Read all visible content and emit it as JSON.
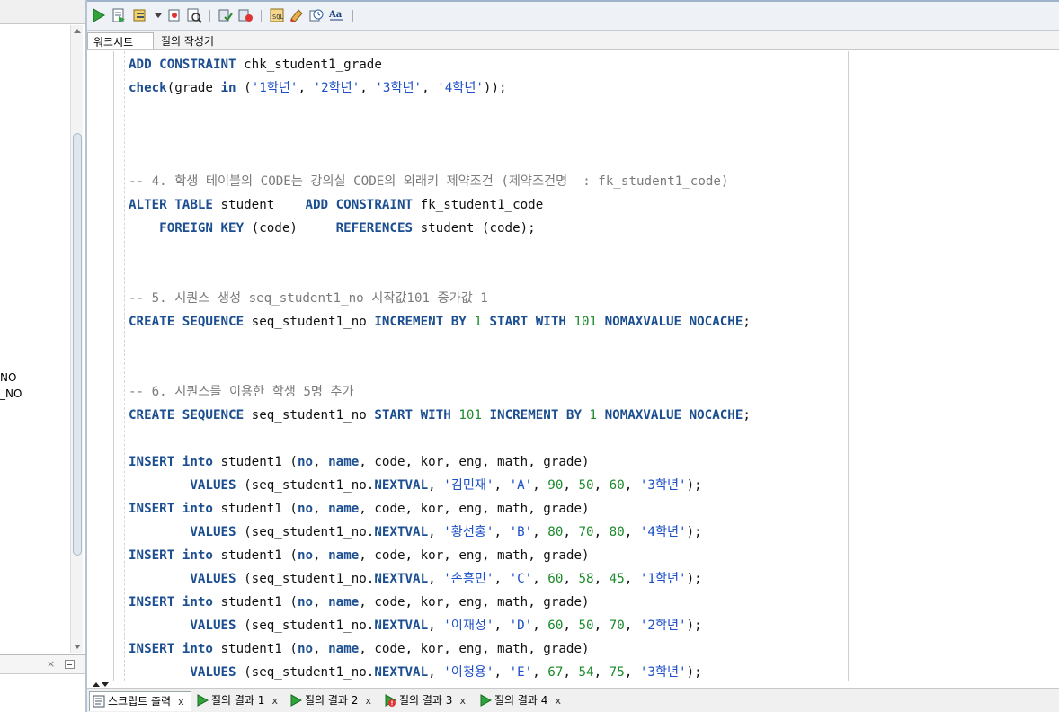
{
  "left_panel": {
    "items": [
      "NO",
      "_NO"
    ]
  },
  "editor": {
    "tabs": [
      "워크시트",
      "질의 작성기"
    ],
    "lines": [
      [
        [
          "kw",
          "ADD CONSTRAINT"
        ],
        [
          "id",
          " chk_student1_grade"
        ]
      ],
      [
        [
          "kw",
          "check"
        ],
        [
          "id",
          "(grade "
        ],
        [
          "kw",
          "in"
        ],
        [
          "id",
          " ("
        ],
        [
          "str",
          "'1학년'"
        ],
        [
          "id",
          ", "
        ],
        [
          "str",
          "'2학년'"
        ],
        [
          "id",
          ", "
        ],
        [
          "str",
          "'3학년'"
        ],
        [
          "id",
          ", "
        ],
        [
          "str",
          "'4학년'"
        ],
        [
          "id",
          "));"
        ]
      ],
      [],
      [],
      [],
      [
        [
          "cmt",
          "-- 4. 학생 테이블의 CODE는 강의실 CODE의 외래키 제약조건 (제약조건명  : fk_student1_code)"
        ]
      ],
      [
        [
          "kw",
          "ALTER TABLE"
        ],
        [
          "id",
          " student    "
        ],
        [
          "kw",
          "ADD CONSTRAINT"
        ],
        [
          "id",
          " fk_student1_code"
        ]
      ],
      [
        [
          "id",
          "    "
        ],
        [
          "kw",
          "FOREIGN KEY"
        ],
        [
          "id",
          " (code)     "
        ],
        [
          "kw",
          "REFERENCES"
        ],
        [
          "id",
          " student (code);"
        ]
      ],
      [],
      [],
      [
        [
          "cmt",
          "-- 5. 시퀀스 생성 seq_student1_no 시작값101 증가값 1"
        ]
      ],
      [
        [
          "kw",
          "CREATE SEQUENCE"
        ],
        [
          "id",
          " seq_student1_no "
        ],
        [
          "kw",
          "INCREMENT BY"
        ],
        [
          "id",
          " "
        ],
        [
          "num",
          "1"
        ],
        [
          "id",
          " "
        ],
        [
          "kw",
          "START WITH"
        ],
        [
          "id",
          " "
        ],
        [
          "num",
          "101"
        ],
        [
          "id",
          " "
        ],
        [
          "kw",
          "NOMAXVALUE NOCACHE"
        ],
        [
          "id",
          ";"
        ]
      ],
      [],
      [],
      [
        [
          "cmt",
          "-- 6. 시퀀스를 이용한 학생 5명 추가"
        ]
      ],
      [
        [
          "kw",
          "CREATE SEQUENCE"
        ],
        [
          "id",
          " seq_student1_no "
        ],
        [
          "kw",
          "START WITH"
        ],
        [
          "id",
          " "
        ],
        [
          "num",
          "101"
        ],
        [
          "id",
          " "
        ],
        [
          "kw",
          "INCREMENT BY"
        ],
        [
          "id",
          " "
        ],
        [
          "num",
          "1"
        ],
        [
          "id",
          " "
        ],
        [
          "kw",
          "NOMAXVALUE NOCACHE"
        ],
        [
          "id",
          ";"
        ]
      ],
      [],
      [
        [
          "kw",
          "INSERT"
        ],
        [
          "id",
          " "
        ],
        [
          "kw",
          "into"
        ],
        [
          "id",
          " student1 ("
        ],
        [
          "kw",
          "no"
        ],
        [
          "id",
          ", "
        ],
        [
          "kw",
          "name"
        ],
        [
          "id",
          ", code, kor, eng, math, grade)"
        ]
      ],
      [
        [
          "id",
          "        "
        ],
        [
          "kw",
          "VALUES"
        ],
        [
          "id",
          " (seq_student1_no."
        ],
        [
          "kw",
          "NEXTVAL"
        ],
        [
          "id",
          ", "
        ],
        [
          "str",
          "'김민재'"
        ],
        [
          "id",
          ", "
        ],
        [
          "str",
          "'A'"
        ],
        [
          "id",
          ", "
        ],
        [
          "num",
          "90"
        ],
        [
          "id",
          ", "
        ],
        [
          "num",
          "50"
        ],
        [
          "id",
          ", "
        ],
        [
          "num",
          "60"
        ],
        [
          "id",
          ", "
        ],
        [
          "str",
          "'3학년'"
        ],
        [
          "id",
          ");"
        ]
      ],
      [
        [
          "kw",
          "INSERT"
        ],
        [
          "id",
          " "
        ],
        [
          "kw",
          "into"
        ],
        [
          "id",
          " student1 ("
        ],
        [
          "kw",
          "no"
        ],
        [
          "id",
          ", "
        ],
        [
          "kw",
          "name"
        ],
        [
          "id",
          ", code, kor, eng, math, grade)"
        ]
      ],
      [
        [
          "id",
          "        "
        ],
        [
          "kw",
          "VALUES"
        ],
        [
          "id",
          " (seq_student1_no."
        ],
        [
          "kw",
          "NEXTVAL"
        ],
        [
          "id",
          ", "
        ],
        [
          "str",
          "'황선홍'"
        ],
        [
          "id",
          ", "
        ],
        [
          "str",
          "'B'"
        ],
        [
          "id",
          ", "
        ],
        [
          "num",
          "80"
        ],
        [
          "id",
          ", "
        ],
        [
          "num",
          "70"
        ],
        [
          "id",
          ", "
        ],
        [
          "num",
          "80"
        ],
        [
          "id",
          ", "
        ],
        [
          "str",
          "'4학년'"
        ],
        [
          "id",
          ");"
        ]
      ],
      [
        [
          "kw",
          "INSERT"
        ],
        [
          "id",
          " "
        ],
        [
          "kw",
          "into"
        ],
        [
          "id",
          " student1 ("
        ],
        [
          "kw",
          "no"
        ],
        [
          "id",
          ", "
        ],
        [
          "kw",
          "name"
        ],
        [
          "id",
          ", code, kor, eng, math, grade)"
        ]
      ],
      [
        [
          "id",
          "        "
        ],
        [
          "kw",
          "VALUES"
        ],
        [
          "id",
          " (seq_student1_no."
        ],
        [
          "kw",
          "NEXTVAL"
        ],
        [
          "id",
          ", "
        ],
        [
          "str",
          "'손흥민'"
        ],
        [
          "id",
          ", "
        ],
        [
          "str",
          "'C'"
        ],
        [
          "id",
          ", "
        ],
        [
          "num",
          "60"
        ],
        [
          "id",
          ", "
        ],
        [
          "num",
          "58"
        ],
        [
          "id",
          ", "
        ],
        [
          "num",
          "45"
        ],
        [
          "id",
          ", "
        ],
        [
          "str",
          "'1학년'"
        ],
        [
          "id",
          ");"
        ]
      ],
      [
        [
          "kw",
          "INSERT"
        ],
        [
          "id",
          " "
        ],
        [
          "kw",
          "into"
        ],
        [
          "id",
          " student1 ("
        ],
        [
          "kw",
          "no"
        ],
        [
          "id",
          ", "
        ],
        [
          "kw",
          "name"
        ],
        [
          "id",
          ", code, kor, eng, math, grade)"
        ]
      ],
      [
        [
          "id",
          "        "
        ],
        [
          "kw",
          "VALUES"
        ],
        [
          "id",
          " (seq_student1_no."
        ],
        [
          "kw",
          "NEXTVAL"
        ],
        [
          "id",
          ", "
        ],
        [
          "str",
          "'이재성'"
        ],
        [
          "id",
          ", "
        ],
        [
          "str",
          "'D'"
        ],
        [
          "id",
          ", "
        ],
        [
          "num",
          "60"
        ],
        [
          "id",
          ", "
        ],
        [
          "num",
          "50"
        ],
        [
          "id",
          ", "
        ],
        [
          "num",
          "70"
        ],
        [
          "id",
          ", "
        ],
        [
          "str",
          "'2학년'"
        ],
        [
          "id",
          ");"
        ]
      ],
      [
        [
          "kw",
          "INSERT"
        ],
        [
          "id",
          " "
        ],
        [
          "kw",
          "into"
        ],
        [
          "id",
          " student1 ("
        ],
        [
          "kw",
          "no"
        ],
        [
          "id",
          ", "
        ],
        [
          "kw",
          "name"
        ],
        [
          "id",
          ", code, kor, eng, math, grade)"
        ]
      ],
      [
        [
          "id",
          "        "
        ],
        [
          "kw",
          "VALUES"
        ],
        [
          "id",
          " (seq_student1_no."
        ],
        [
          "kw",
          "NEXTVAL"
        ],
        [
          "id",
          ", "
        ],
        [
          "str",
          "'이청용'"
        ],
        [
          "id",
          ", "
        ],
        [
          "str",
          "'E'"
        ],
        [
          "id",
          ", "
        ],
        [
          "num",
          "67"
        ],
        [
          "id",
          ", "
        ],
        [
          "num",
          "54"
        ],
        [
          "id",
          ", "
        ],
        [
          "num",
          "75"
        ],
        [
          "id",
          ", "
        ],
        [
          "str",
          "'3학년'"
        ],
        [
          "id",
          ");"
        ]
      ]
    ]
  },
  "results_tabs": [
    {
      "label": "스크립트 출력",
      "icon": "script-output-icon",
      "close": "x"
    },
    {
      "label": "질의 결과 1",
      "icon": "run-icon",
      "close": "x"
    },
    {
      "label": "질의 결과 2",
      "icon": "run-icon",
      "close": "x"
    },
    {
      "label": "질의 결과 3",
      "icon": "error-icon",
      "close": "x"
    },
    {
      "label": "질의 결과 4",
      "icon": "run-icon",
      "close": "x"
    }
  ],
  "left_bottom_close": "×",
  "colors": {
    "keyword": "#1c4f91",
    "string": "#1c4fc7",
    "number": "#1a8a2a",
    "comment": "#7b7b7b"
  }
}
